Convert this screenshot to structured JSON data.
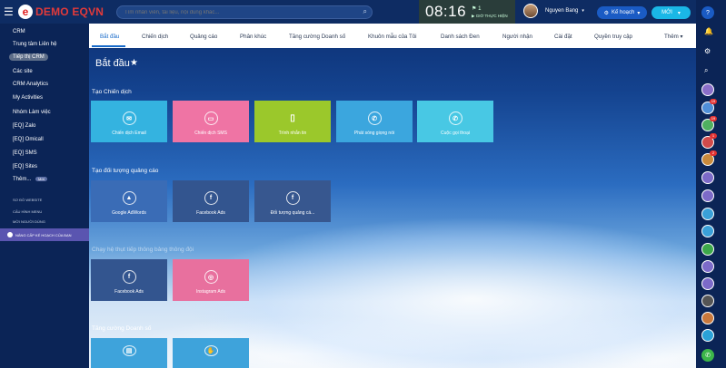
{
  "header": {
    "brand_letter": "e",
    "brand_name": "DEMO EQVN",
    "search_placeholder": "Tìm nhân viên, tài liệu, nội dung khác...",
    "clock_time": "08:16",
    "clock_count": "1",
    "clock_label": "GIỜ THỰC HIỆN",
    "user_name": "Nguyen Bang",
    "plan_label": "Kế hoạch",
    "new_label": "MỚI"
  },
  "sidebar": {
    "items": [
      {
        "label": "CRM"
      },
      {
        "label": "Trung tâm Liên hệ"
      },
      {
        "label": "Tiếp thị CRM",
        "active": true
      },
      {
        "label": "Các site"
      },
      {
        "label": "CRM Analytics"
      },
      {
        "label": "My Activities"
      },
      {
        "label": "Nhóm Làm việc"
      },
      {
        "label": "[EQ] Zalo"
      },
      {
        "label": "[EQ] Omicall"
      },
      {
        "label": "[EQ] SMS"
      },
      {
        "label": "[EQ] Sites"
      },
      {
        "label": "Thêm..."
      }
    ],
    "more_badge": "Mới",
    "small_links": [
      "SƠ ĐỒ WEBSITE",
      "CẤU HÌNH MENU",
      "MỜI NGƯỜI DÙNG"
    ],
    "upgrade_label": "NÂNG CẤP KẾ HOẠCH CỦA BẠN"
  },
  "tabs": [
    {
      "label": "Bắt đầu",
      "active": true
    },
    {
      "label": "Chiến dịch"
    },
    {
      "label": "Quảng cáo"
    },
    {
      "label": "Phân khúc"
    },
    {
      "label": "Tăng cường Doanh số"
    },
    {
      "label": "Khuôn mẫu của Tôi"
    },
    {
      "label": "Danh sách Đen"
    },
    {
      "label": "Người nhận"
    },
    {
      "label": "Cài đặt"
    },
    {
      "label": "Quyền truy cập"
    },
    {
      "label": "Thêm"
    }
  ],
  "page_title": "Bắt đầu",
  "sections": [
    {
      "title": "Tạo Chiến dịch",
      "cards": [
        {
          "label": "Chiến dịch Email",
          "icon": "email-icon"
        },
        {
          "label": "Chiến dịch SMS",
          "icon": "sms-icon"
        },
        {
          "label": "Trình nhắn tin",
          "icon": "mobile-icon"
        },
        {
          "label": "Phát sóng giọng nói",
          "icon": "phone-icon"
        },
        {
          "label": "Cuộc gọi thoại",
          "icon": "phone-icon"
        }
      ]
    },
    {
      "title": "Tạo đối tượng quảng cáo",
      "cards": [
        {
          "label": "Google AdWords",
          "icon": "adwords-icon"
        },
        {
          "label": "Facebook Ads",
          "icon": "facebook-icon"
        },
        {
          "label": "Đối tượng quảng cá...",
          "icon": "facebook-icon"
        }
      ]
    },
    {
      "title": "Chạy hệ thụt tiếp thông bảng thông đội",
      "cards": [
        {
          "label": "Facebook Ads",
          "icon": "facebook-icon"
        },
        {
          "label": "Instagram Ads",
          "icon": "instagram-icon"
        }
      ]
    },
    {
      "title": "Tăng cường Doanh số",
      "cards": [
        {
          "label": "",
          "icon": "chat-icon"
        },
        {
          "label": "",
          "icon": "handshake-icon"
        }
      ]
    }
  ],
  "right_rail": {
    "badges": [
      "19",
      "19",
      "1",
      "2"
    ]
  }
}
